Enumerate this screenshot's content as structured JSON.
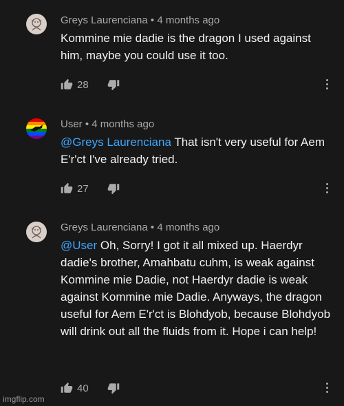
{
  "comments": [
    {
      "author": "Greys Laurenciana",
      "time": "4 months ago",
      "mention": "",
      "text": "Kommine mie dadie is the dragon I used against him, maybe you could use it too.",
      "likes": "28",
      "avatar": "dragon-drawing-avatar"
    },
    {
      "author": "User",
      "time": "4 months ago",
      "mention": "@Greys Laurenciana",
      "text": "That isn't very useful for Aem E'r'ct I've already tried.",
      "likes": "27",
      "avatar": "rainbow-flag-avatar"
    },
    {
      "author": "Greys Laurenciana",
      "time": "4 months ago",
      "mention": "@User",
      "text": "Oh, Sorry! I got it all mixed up. Haerdyr dadie's brother, Amahbatu cuhm, is weak against Kommine mie Dadie, not Haerdyr dadie is weak against Kommine mie Dadie. Anyways, the dragon useful for Aem E'r'ct is Blohdyob, because Blohdyob will drink out all the fluids from it. Hope i can help!",
      "likes": "40",
      "avatar": "dragon-drawing-avatar"
    }
  ],
  "separator": " • ",
  "watermark": "imgflip.com",
  "colors": {
    "background": "#181818",
    "text": "#f1f1f1",
    "meta": "#aaaaaa",
    "mention": "#3ea6ff"
  }
}
